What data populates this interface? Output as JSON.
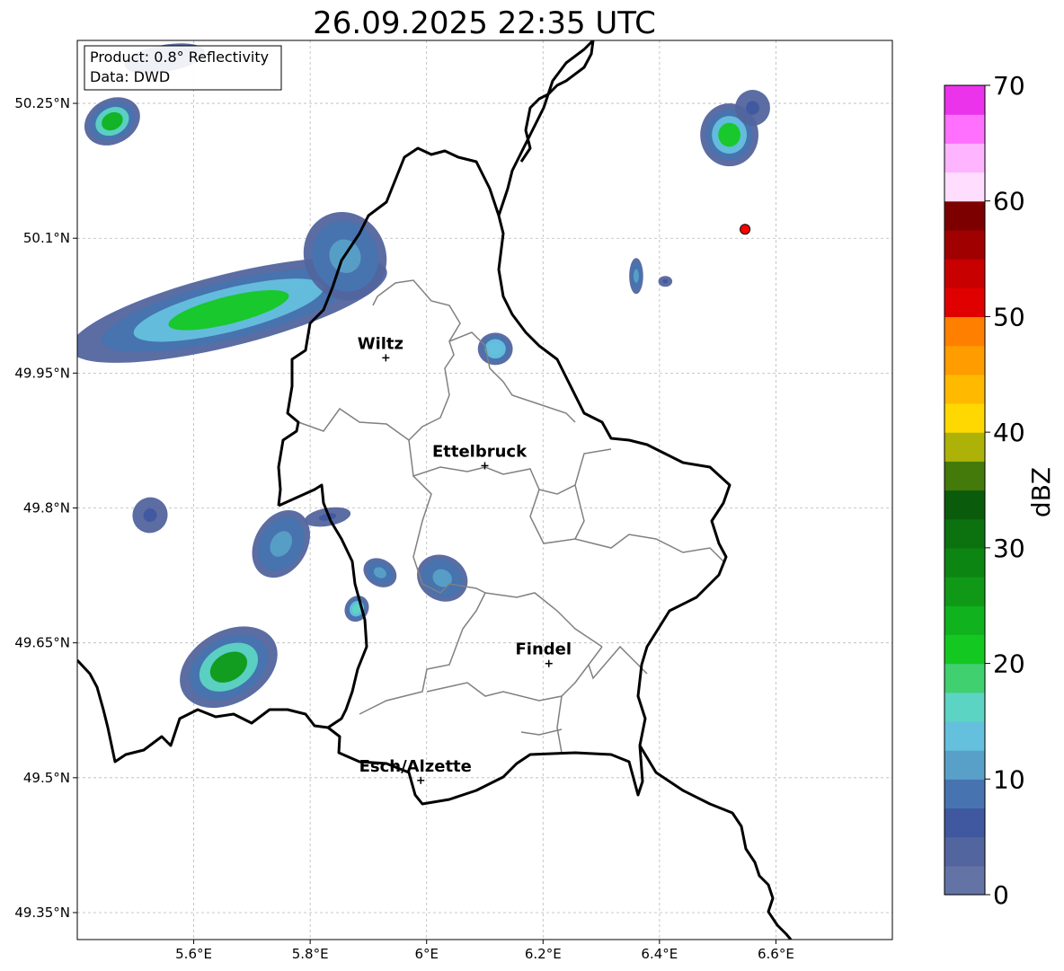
{
  "title": "26.09.2025 22:35 UTC",
  "info_box": {
    "product": "Product: 0.8° Reflectivity",
    "source": "Data: DWD"
  },
  "map": {
    "lon_range": [
      5.4,
      6.8
    ],
    "lat_range": [
      49.32,
      50.32
    ],
    "x_ticks": [
      {
        "value": 5.6,
        "label": "5.6°E"
      },
      {
        "value": 5.8,
        "label": "5.8°E"
      },
      {
        "value": 6.0,
        "label": "6°E"
      },
      {
        "value": 6.2,
        "label": "6.2°E"
      },
      {
        "value": 6.4,
        "label": "6.4°E"
      },
      {
        "value": 6.6,
        "label": "6.6°E"
      }
    ],
    "y_ticks": [
      {
        "value": 50.25,
        "label": "50.25°N"
      },
      {
        "value": 50.1,
        "label": "50.1°N"
      },
      {
        "value": 49.95,
        "label": "49.95°N"
      },
      {
        "value": 49.8,
        "label": "49.8°N"
      },
      {
        "value": 49.65,
        "label": "49.65°N"
      },
      {
        "value": 49.5,
        "label": "49.5°N"
      },
      {
        "value": 49.35,
        "label": "49.35°N"
      }
    ],
    "grid": true,
    "cities": [
      {
        "name": "Wiltz",
        "lon": 5.93,
        "lat": 49.967
      },
      {
        "name": "Ettelbruck",
        "lon": 6.1,
        "lat": 49.847
      },
      {
        "name": "Findel",
        "lon": 6.21,
        "lat": 49.627
      },
      {
        "name": "Esch/Alzette",
        "lon": 5.99,
        "lat": 49.497
      }
    ],
    "radar_site": {
      "lon": 6.547,
      "lat": 50.11,
      "color": "#ff0000"
    },
    "echoes": [
      {
        "lon": 5.46,
        "lat": 50.23,
        "rx": 0.05,
        "ry": 0.025,
        "rot": -28,
        "dbz": 24
      },
      {
        "lon": 5.55,
        "lat": 50.3,
        "rx": 0.07,
        "ry": 0.015,
        "rot": -10,
        "dbz": 8
      },
      {
        "lon": 5.66,
        "lat": 50.02,
        "rx": 0.28,
        "ry": 0.04,
        "rot": -14,
        "dbz": 20
      },
      {
        "lon": 5.86,
        "lat": 50.08,
        "rx": 0.07,
        "ry": 0.05,
        "rot": -25,
        "dbz": 12
      },
      {
        "lon": 6.118,
        "lat": 49.977,
        "rx": 0.03,
        "ry": 0.018,
        "rot": 0,
        "dbz": 14
      },
      {
        "lon": 6.52,
        "lat": 50.215,
        "rx": 0.05,
        "ry": 0.035,
        "rot": 0,
        "dbz": 22
      },
      {
        "lon": 6.56,
        "lat": 50.245,
        "rx": 0.03,
        "ry": 0.02,
        "rot": 0,
        "dbz": 6
      },
      {
        "lon": 6.36,
        "lat": 50.058,
        "rx": 0.012,
        "ry": 0.02,
        "rot": 0,
        "dbz": 10
      },
      {
        "lon": 6.41,
        "lat": 50.052,
        "rx": 0.012,
        "ry": 0.006,
        "rot": 0,
        "dbz": 6
      },
      {
        "lon": 5.525,
        "lat": 49.792,
        "rx": 0.03,
        "ry": 0.02,
        "rot": 30,
        "dbz": 7
      },
      {
        "lon": 5.75,
        "lat": 49.76,
        "rx": 0.045,
        "ry": 0.04,
        "rot": 30,
        "dbz": 12
      },
      {
        "lon": 5.83,
        "lat": 49.79,
        "rx": 0.04,
        "ry": 0.01,
        "rot": -10,
        "dbz": 6
      },
      {
        "lon": 5.92,
        "lat": 49.728,
        "rx": 0.03,
        "ry": 0.015,
        "rot": 30,
        "dbz": 10
      },
      {
        "lon": 6.027,
        "lat": 49.722,
        "rx": 0.045,
        "ry": 0.025,
        "rot": 30,
        "dbz": 12
      },
      {
        "lon": 5.88,
        "lat": 49.688,
        "rx": 0.02,
        "ry": 0.015,
        "rot": 30,
        "dbz": 16
      },
      {
        "lon": 5.66,
        "lat": 49.623,
        "rx": 0.09,
        "ry": 0.04,
        "rot": -30,
        "dbz": 26
      }
    ]
  },
  "colorbar": {
    "label": "dBZ",
    "min": 0,
    "max": 70,
    "ticks": [
      {
        "value": 0,
        "label": "0"
      },
      {
        "value": 10,
        "label": "10"
      },
      {
        "value": 20,
        "label": "20"
      },
      {
        "value": 30,
        "label": "30"
      },
      {
        "value": 40,
        "label": "40"
      },
      {
        "value": 50,
        "label": "50"
      },
      {
        "value": 60,
        "label": "60"
      },
      {
        "value": 70,
        "label": "70"
      }
    ],
    "colors": [
      "#6373a6",
      "#52659e",
      "#3f58a0",
      "#4774b0",
      "#58a0c8",
      "#65c0de",
      "#5cd4c3",
      "#40d070",
      "#14c822",
      "#10b21e",
      "#0f9917",
      "#0d8512",
      "#0b720f",
      "#0a5c0c",
      "#437a0a",
      "#acb208",
      "#fed800",
      "#ffba00",
      "#ff9c00",
      "#ff8000",
      "#e10000",
      "#c80000",
      "#a00000",
      "#7d0000",
      "#ffddff",
      "#ffb4ff",
      "#ff70ff",
      "#ec33ec"
    ]
  }
}
